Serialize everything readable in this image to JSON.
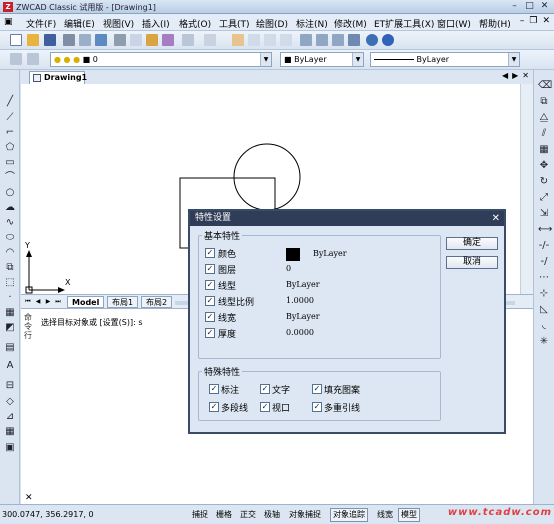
{
  "window": {
    "title": "ZWCAD Classic 试用版 - [Drawing1]",
    "logo_text": "Z"
  },
  "menu": [
    "文件(F)",
    "编辑(E)",
    "视图(V)",
    "插入(I)",
    "格式(O)",
    "工具(T)",
    "绘图(D)",
    "标注(N)",
    "修改(M)",
    "ET扩展工具(X)",
    "窗口(W)",
    "帮助(H)"
  ],
  "layer_toolbar": {
    "layer_value": "0",
    "color_value": "ByLayer",
    "linetype_value": "ByLayer"
  },
  "document_tab": "Drawing1",
  "layout_tabs": [
    "Model",
    "布局1",
    "布局2"
  ],
  "axis_labels": {
    "x": "X",
    "y": "Y"
  },
  "command": {
    "label": "命令行",
    "text": "选择目标对象或 [设置(S)]: s"
  },
  "status": {
    "coords": "300.0747,  356.2917,  0",
    "buttons": [
      "捕捉",
      "栅格",
      "正交",
      "极轴",
      "对象捕捉",
      "对象追踪",
      "线宽",
      "模型"
    ],
    "watermark": "www.tcadw.com"
  },
  "dialog": {
    "title": "特性设置",
    "basic_legend": "基本特性",
    "basic_props": [
      {
        "label": "颜色",
        "value": "ByLayer",
        "checked": true
      },
      {
        "label": "图层",
        "value": "0",
        "checked": true
      },
      {
        "label": "线型",
        "value": "ByLayer",
        "checked": true
      },
      {
        "label": "线型比例",
        "value": "1.0000",
        "checked": true
      },
      {
        "label": "线宽",
        "value": "ByLayer",
        "checked": true
      },
      {
        "label": "厚度",
        "value": "0.0000",
        "checked": true
      }
    ],
    "special_legend": "特殊特性",
    "special_props": [
      {
        "label": "标注",
        "checked": true
      },
      {
        "label": "文字",
        "checked": true
      },
      {
        "label": "填充图案",
        "checked": true
      },
      {
        "label": "多段线",
        "checked": true
      },
      {
        "label": "视口",
        "checked": true
      },
      {
        "label": "多重引线",
        "checked": true
      }
    ],
    "ok": "确定",
    "cancel": "取消"
  },
  "colors": {
    "dialog_title_bg": "#2f3d58",
    "panel_bg": "#dde7f3",
    "color_swatch": "#000000"
  }
}
